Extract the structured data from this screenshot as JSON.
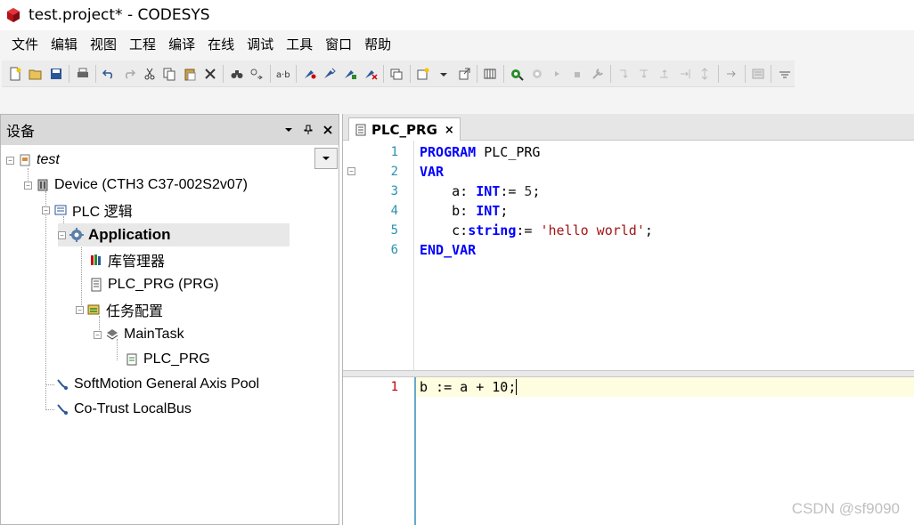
{
  "window": {
    "title": "test.project* - CODESYS"
  },
  "menu": [
    "文件",
    "编辑",
    "视图",
    "工程",
    "编译",
    "在线",
    "调试",
    "工具",
    "窗口",
    "帮助"
  ],
  "device_panel": {
    "title": "设备",
    "tree": [
      {
        "label": "test",
        "style": "italic",
        "icon": "project-icon"
      },
      {
        "label": "Device (CTH3 C37-002S2v07)",
        "icon": "device-icon"
      },
      {
        "label": "PLC 逻辑",
        "icon": "plc-logic-icon"
      },
      {
        "label": "Application",
        "style": "bold",
        "icon": "gear-icon",
        "selected": true
      },
      {
        "label": "库管理器",
        "icon": "library-icon"
      },
      {
        "label": "PLC_PRG (PRG)",
        "icon": "pou-icon"
      },
      {
        "label": "任务配置",
        "icon": "task-config-icon"
      },
      {
        "label": "MainTask",
        "icon": "task-icon"
      },
      {
        "label": "PLC_PRG",
        "icon": "program-call-icon"
      },
      {
        "label": "SoftMotion General Axis Pool",
        "icon": "axis-pool-icon"
      },
      {
        "label": "Co-Trust LocalBus",
        "icon": "bus-icon"
      }
    ]
  },
  "editor": {
    "tab_label": "PLC_PRG",
    "declaration": [
      {
        "num": "1",
        "tokens": [
          [
            "kw",
            "PROGRAM"
          ],
          [
            "",
            " PLC_PRG"
          ]
        ]
      },
      {
        "num": "2",
        "tokens": [
          [
            "kw",
            "VAR"
          ]
        ]
      },
      {
        "num": "3",
        "tokens": [
          [
            "",
            "    a: "
          ],
          [
            "kw",
            "INT"
          ],
          [
            "",
            ":= "
          ],
          [
            "num",
            "5"
          ],
          [
            "",
            ";"
          ]
        ]
      },
      {
        "num": "4",
        "tokens": [
          [
            "",
            "    b: "
          ],
          [
            "kw",
            "INT"
          ],
          [
            "",
            ";"
          ]
        ]
      },
      {
        "num": "5",
        "tokens": [
          [
            "",
            "    c:"
          ],
          [
            "kw",
            "string"
          ],
          [
            "",
            ":= "
          ],
          [
            "str",
            "'hello world'"
          ],
          [
            "",
            ";"
          ]
        ]
      },
      {
        "num": "6",
        "tokens": [
          [
            "kw",
            "END_VAR"
          ]
        ]
      }
    ],
    "implementation": [
      {
        "num": "1",
        "text": "b := a + 10;"
      }
    ]
  },
  "watermark": "CSDN @sf9090",
  "colors": {
    "keyword": "#0000ff",
    "string": "#a31515",
    "line_number": "#2b91af",
    "error_line_number": "#c00000"
  }
}
